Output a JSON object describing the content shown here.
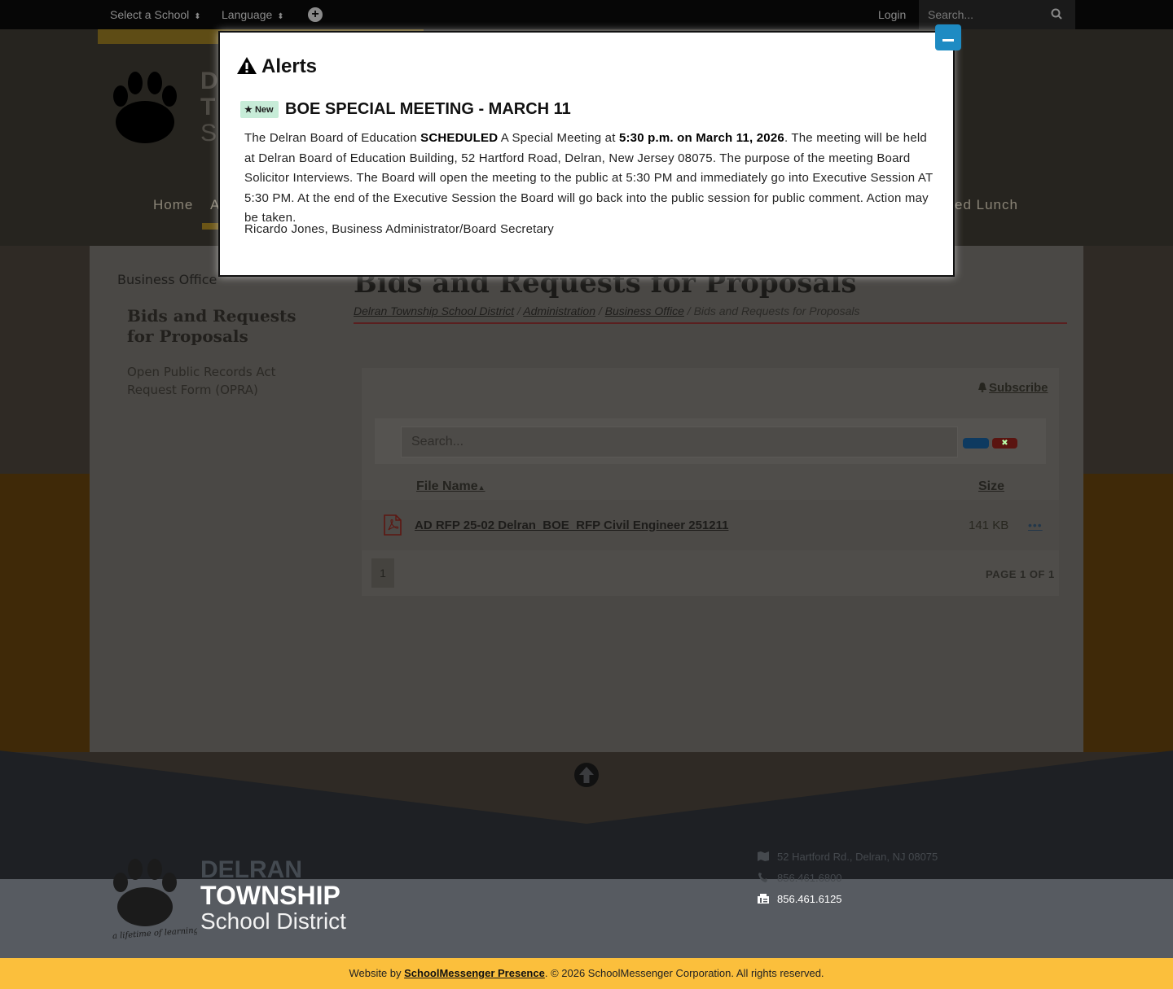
{
  "topbar": {
    "select_school": "Select a School",
    "language": "Language",
    "login": "Login",
    "search_placeholder": "Search..."
  },
  "header": {
    "logo_letters": "D\nT\nS",
    "nav_home": "Home",
    "nav_a": "A",
    "nav_lunch": "ed Lunch"
  },
  "sidebar": {
    "title": "Business Office",
    "items": [
      {
        "label": "Bids and Requests for Proposals",
        "active": true
      },
      {
        "label": "Open Public Records Act Request Form (OPRA)",
        "active": false
      }
    ]
  },
  "main": {
    "title": "Bids and Requests for Proposals",
    "breadcrumb": [
      {
        "label": "Delran Township School District",
        "link": true
      },
      {
        "label": "Administration",
        "link": true
      },
      {
        "label": "Business Office",
        "link": true
      },
      {
        "label": "Bids and Requests for Proposals",
        "link": false
      }
    ],
    "files": {
      "subscribe": "Subscribe",
      "search_placeholder": "Search...",
      "clear_label": "✖",
      "col_name": "File Name",
      "col_size": "Size",
      "rows": [
        {
          "name": "AD RFP 25-02 Delran_BOE_RFP Civil Engineer 251211",
          "size": "141 KB",
          "more": "•••"
        }
      ],
      "page_button": "1",
      "page_of": "PAGE 1 OF 1"
    }
  },
  "alert": {
    "heading": "Alerts",
    "badge": "New",
    "title": "BOE SPECIAL MEETING - MARCH 11",
    "body_1": "The Delran Board of Education ",
    "body_b1": "SCHEDULED",
    "body_2": " A Special Meeting at ",
    "body_b2": "5:30 p.m. on March 11, 2026",
    "body_3": ". The meeting will be held at Delran Board of Education Building, 52 Hartford Road, Delran, New Jersey 08075. The purpose of the meeting Board Solicitor Interviews. The Board will open the meeting to the public at 5:30 PM and immediately go into Executive Session AT 5:30 PM. At the end of the Executive Session the Board will go back into the public session for public comment.  Action may be taken.",
    "signature": "Ricardo Jones, Business Administrator/Board Secretary"
  },
  "footer": {
    "delran": "DELRAN",
    "township": "TOWNSHIP",
    "school": "School District",
    "tagline": "a lifetime of learning",
    "address": "52 Hartford Rd., Delran, NJ 08075",
    "phone": "856.461.6800",
    "fax": "856.461.6125",
    "credit_prefix": "Website by ",
    "credit_link": "SchoolMessenger Presence",
    "credit_suffix": ". © 2026 SchoolMessenger Corporation. All rights reserved."
  },
  "colors": {
    "accent_gold": "#fbbf3c",
    "minimize_blue": "#1e8bc3",
    "badge_green": "#c7ecd8"
  }
}
